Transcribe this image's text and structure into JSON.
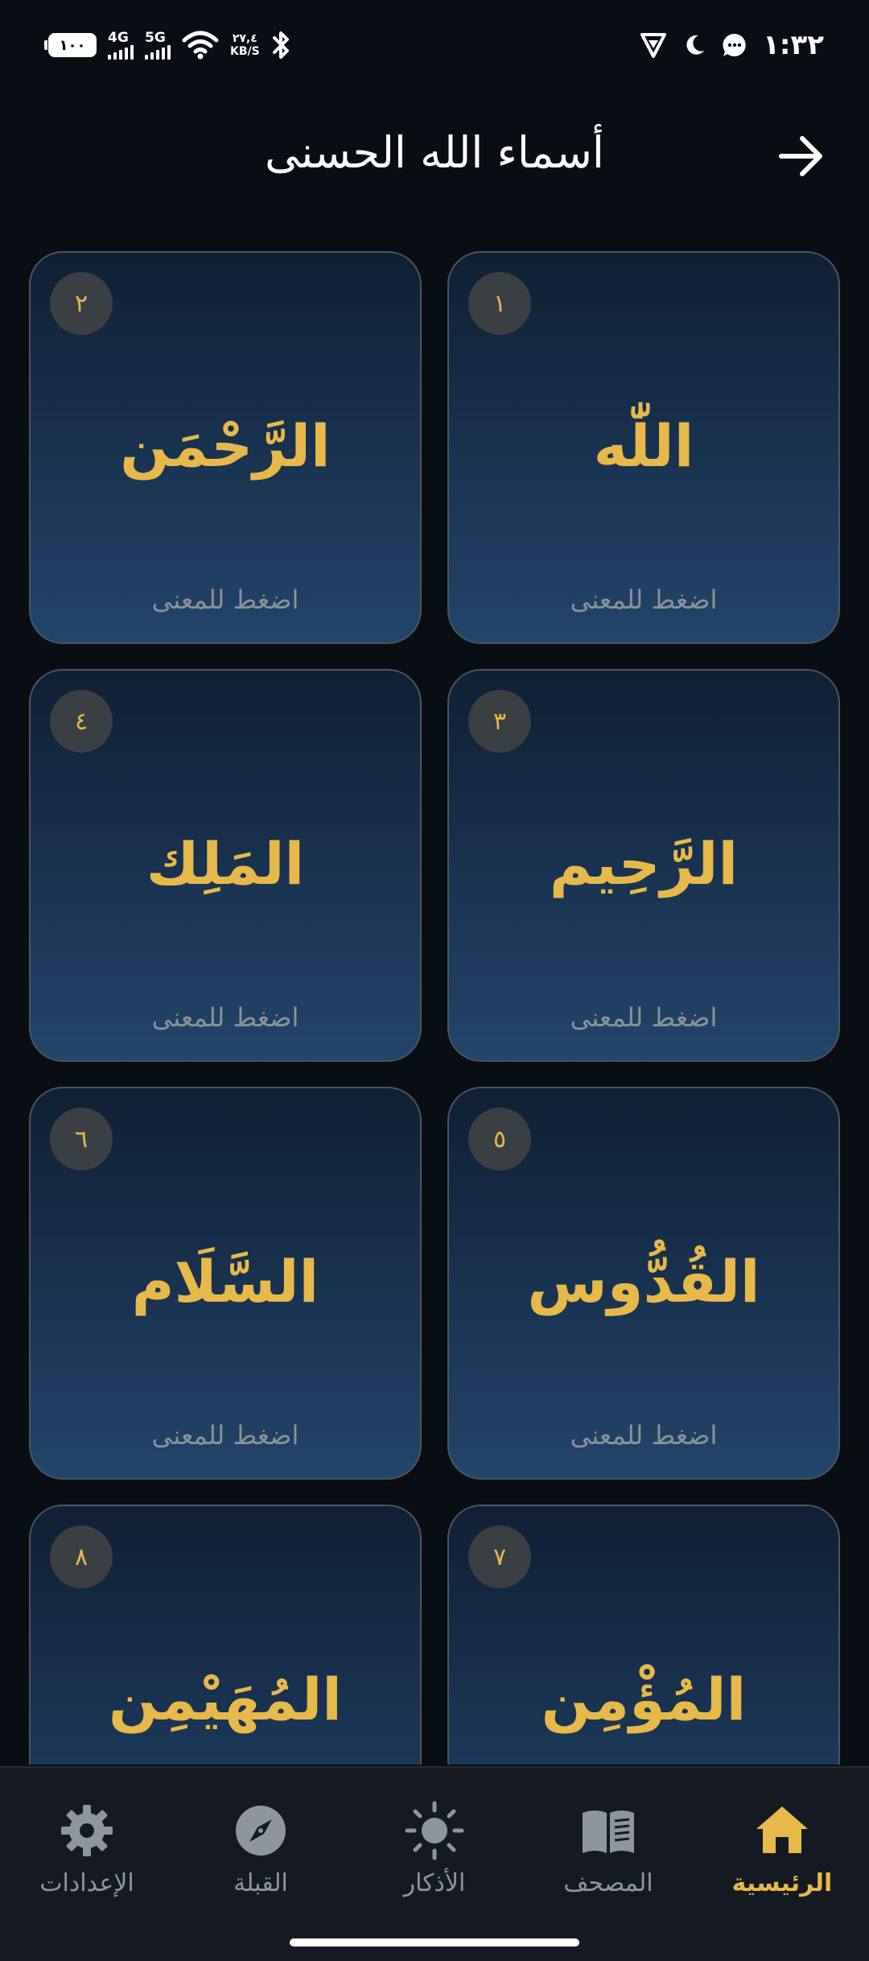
{
  "status_bar": {
    "battery": "١٠٠",
    "network_1": "4G",
    "network_2": "5G",
    "speed_value": "٢٧,٤",
    "speed_unit": "KB/S",
    "time": "١:٣٢"
  },
  "header": {
    "title": "أسماء الله الحسنى"
  },
  "hint_text": "اضغط للمعنى",
  "names": [
    {
      "number": "١",
      "name": "اللّٰه"
    },
    {
      "number": "٢",
      "name": "الرَّحْمَن"
    },
    {
      "number": "٣",
      "name": "الرَّحِيم"
    },
    {
      "number": "٤",
      "name": "المَلِك"
    },
    {
      "number": "٥",
      "name": "القُدُّوس"
    },
    {
      "number": "٦",
      "name": "السَّلَام"
    },
    {
      "number": "٧",
      "name": "المُؤْمِن"
    },
    {
      "number": "٨",
      "name": "المُهَيْمِن"
    }
  ],
  "nav": {
    "items": [
      {
        "label": "الرئيسية",
        "icon": "home-icon",
        "active": true
      },
      {
        "label": "المصحف",
        "icon": "book-icon",
        "active": false
      },
      {
        "label": "الأذكار",
        "icon": "sun-icon",
        "active": false
      },
      {
        "label": "القبلة",
        "icon": "compass-icon",
        "active": false
      },
      {
        "label": "الإعدادات",
        "icon": "gear-icon",
        "active": false
      }
    ]
  },
  "colors": {
    "accent_gold": "#e6b94a",
    "card_top": "#0f1f35",
    "card_bottom": "#22456a",
    "background": "#090d14"
  }
}
